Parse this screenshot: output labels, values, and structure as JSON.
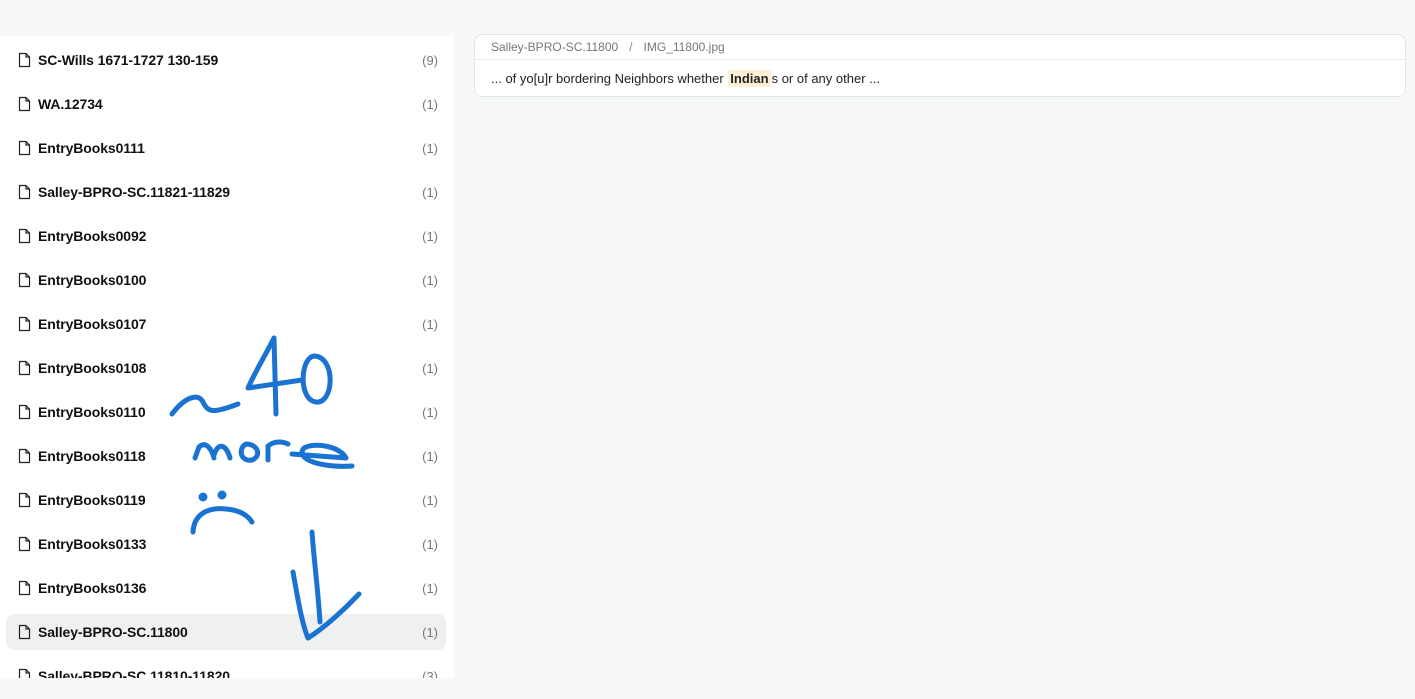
{
  "sidebar": {
    "items": [
      {
        "label": "SC-Wills 1671-1727 130-159",
        "count": "(9)"
      },
      {
        "label": "WA.12734",
        "count": "(1)"
      },
      {
        "label": "EntryBooks0111",
        "count": "(1)"
      },
      {
        "label": "Salley-BPRO-SC.11821-11829",
        "count": "(1)"
      },
      {
        "label": "EntryBooks0092",
        "count": "(1)"
      },
      {
        "label": "EntryBooks0100",
        "count": "(1)"
      },
      {
        "label": "EntryBooks0107",
        "count": "(1)"
      },
      {
        "label": "EntryBooks0108",
        "count": "(1)"
      },
      {
        "label": "EntryBooks0110",
        "count": "(1)"
      },
      {
        "label": "EntryBooks0118",
        "count": "(1)"
      },
      {
        "label": "EntryBooks0119",
        "count": "(1)"
      },
      {
        "label": "EntryBooks0133",
        "count": "(1)"
      },
      {
        "label": "EntryBooks0136",
        "count": "(1)"
      },
      {
        "label": "Salley-BPRO-SC.11800",
        "count": "(1)",
        "selected": true
      },
      {
        "label": "Salley-BPRO-SC.11810-11820",
        "count": "(3)"
      }
    ],
    "icon": "file-icon"
  },
  "result": {
    "breadcrumb": {
      "collection": "Salley-BPRO-SC.11800",
      "separator": "/",
      "file": "IMG_11800.jpg"
    },
    "snippet": {
      "before": "... of yo[u]r bordering Neighbors whether ",
      "highlight": "Indian",
      "after": "s or of any other ..."
    }
  },
  "annotation": {
    "color": "#1a73d1",
    "text": "~40 more :( ↓"
  }
}
